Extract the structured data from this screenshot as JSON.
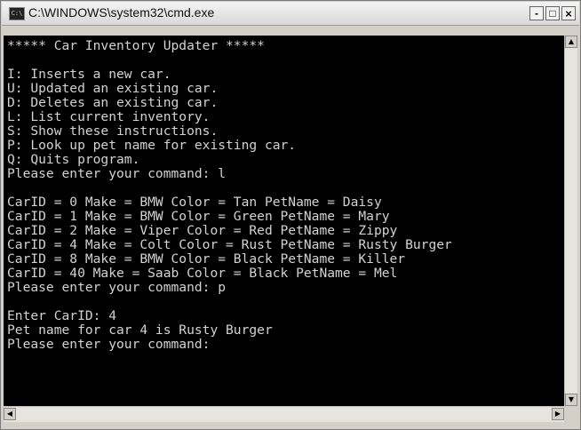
{
  "window": {
    "title": "C:\\WINDOWS\\system32\\cmd.exe",
    "icon_text": "C:\\",
    "controls": {
      "minimize": "-",
      "maximize": "□",
      "close": "×"
    }
  },
  "console": {
    "lines": [
      "***** Car Inventory Updater *****",
      "",
      "I: Inserts a new car.",
      "U: Updated an existing car.",
      "D: Deletes an existing car.",
      "L: List current inventory.",
      "S: Show these instructions.",
      "P: Look up pet name for existing car.",
      "Q: Quits program.",
      "Please enter your command: l",
      "",
      "CarID = 0 Make = BMW Color = Tan PetName = Daisy",
      "CarID = 1 Make = BMW Color = Green PetName = Mary",
      "CarID = 2 Make = Viper Color = Red PetName = Zippy",
      "CarID = 4 Make = Colt Color = Rust PetName = Rusty Burger",
      "CarID = 8 Make = BMW Color = Black PetName = Killer",
      "CarID = 40 Make = Saab Color = Black PetName = Mel",
      "Please enter your command: p",
      "",
      "Enter CarID: 4",
      "Pet name for car 4 is Rusty Burger",
      "Please enter your command:"
    ]
  },
  "scrollbars": {
    "up_arrow": "▲",
    "down_arrow": "▼",
    "left_arrow": "◀",
    "right_arrow": "▶"
  }
}
